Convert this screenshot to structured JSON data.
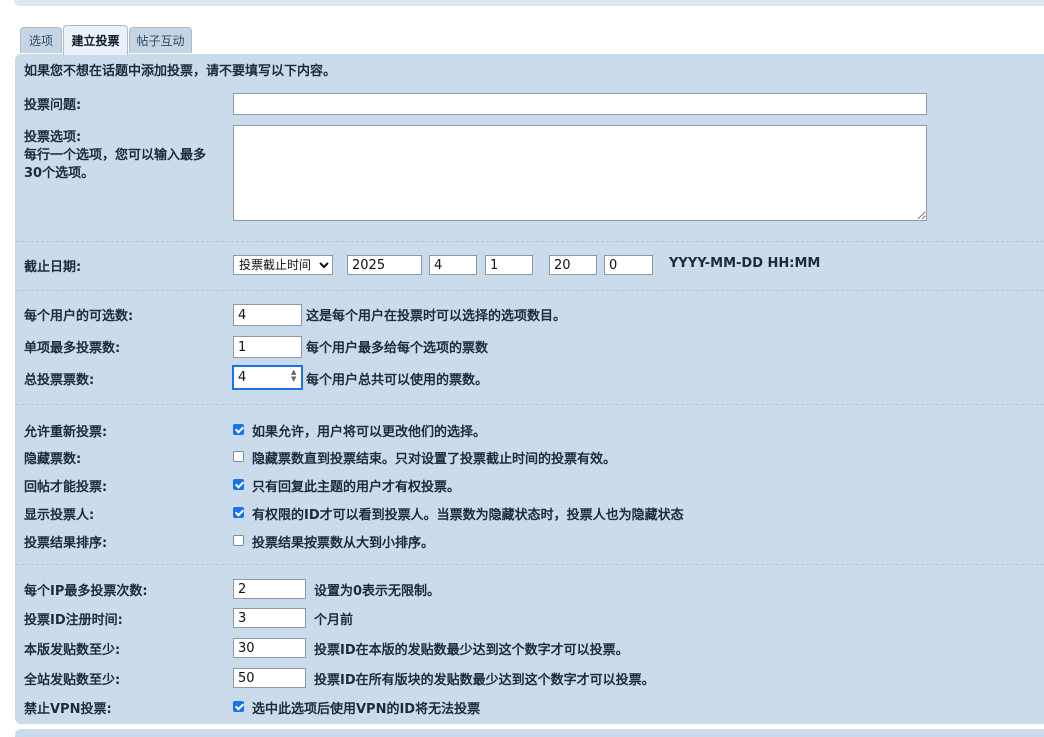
{
  "tabs": [
    {
      "label": "选项"
    },
    {
      "label": "建立投票"
    },
    {
      "label": "帖子互动"
    }
  ],
  "notice": "如果您不想在话题中添加投票，请不要填写以下内容。",
  "poll": {
    "question_label": "投票问题:",
    "question_value": "",
    "options_label_1": "投票选项:",
    "options_label_2": "每行一个选项，您可以输入最多",
    "options_label_3": "30个选项。",
    "options_value": ""
  },
  "deadline": {
    "label": "截止日期:",
    "select_value": "投票截止时间",
    "year": "2025",
    "month": "4",
    "day": "1",
    "hour": "20",
    "minute": "0",
    "format": "YYYY-MM-DD HH:MM"
  },
  "votes": {
    "per_user_label": "每个用户的可选数:",
    "per_user_value": "4",
    "per_user_hint": "这是每个用户在投票时可以选择的选项数目。",
    "max_per_option_label": "单项最多投票数:",
    "max_per_option_value": "1",
    "max_per_option_hint": "每个用户最多给每个选项的票数",
    "total_label": "总投票票数:",
    "total_value": "4",
    "total_hint": "每个用户总共可以使用的票数。"
  },
  "toggles": [
    {
      "label": "允许重新投票:",
      "checked": true,
      "text": "如果允许，用户将可以更改他们的选择。"
    },
    {
      "label": "隐藏票数:",
      "checked": false,
      "text": "隐藏票数直到投票结束。只对设置了投票截止时间的投票有效。"
    },
    {
      "label": "回帖才能投票:",
      "checked": true,
      "text": "只有回复此主题的用户才有权投票。"
    },
    {
      "label": "显示投票人:",
      "checked": true,
      "text": "有权限的ID才可以看到投票人。当票数为隐藏状态时，投票人也为隐藏状态"
    },
    {
      "label": "投票结果排序:",
      "checked": false,
      "text": "投票结果按票数从大到小排序。"
    }
  ],
  "limits": {
    "ip_label": "每个IP最多投票次数:",
    "ip_value": "2",
    "ip_hint": "设置为0表示无限制。",
    "reg_label": "投票ID注册时间:",
    "reg_value": "3",
    "reg_hint": "个月前",
    "board_label": "本版发贴数至少:",
    "board_value": "30",
    "board_hint": "投票ID在本版的发贴数最少达到这个数字才可以投票。",
    "site_label": "全站发贴数至少:",
    "site_value": "50",
    "site_hint": "投票ID在所有版块的发贴数最少达到这个数字才可以投票。",
    "vpn_label": "禁止VPN投票:",
    "vpn_checked": true,
    "vpn_text": "选中此选项后使用VPN的ID将无法投票"
  }
}
